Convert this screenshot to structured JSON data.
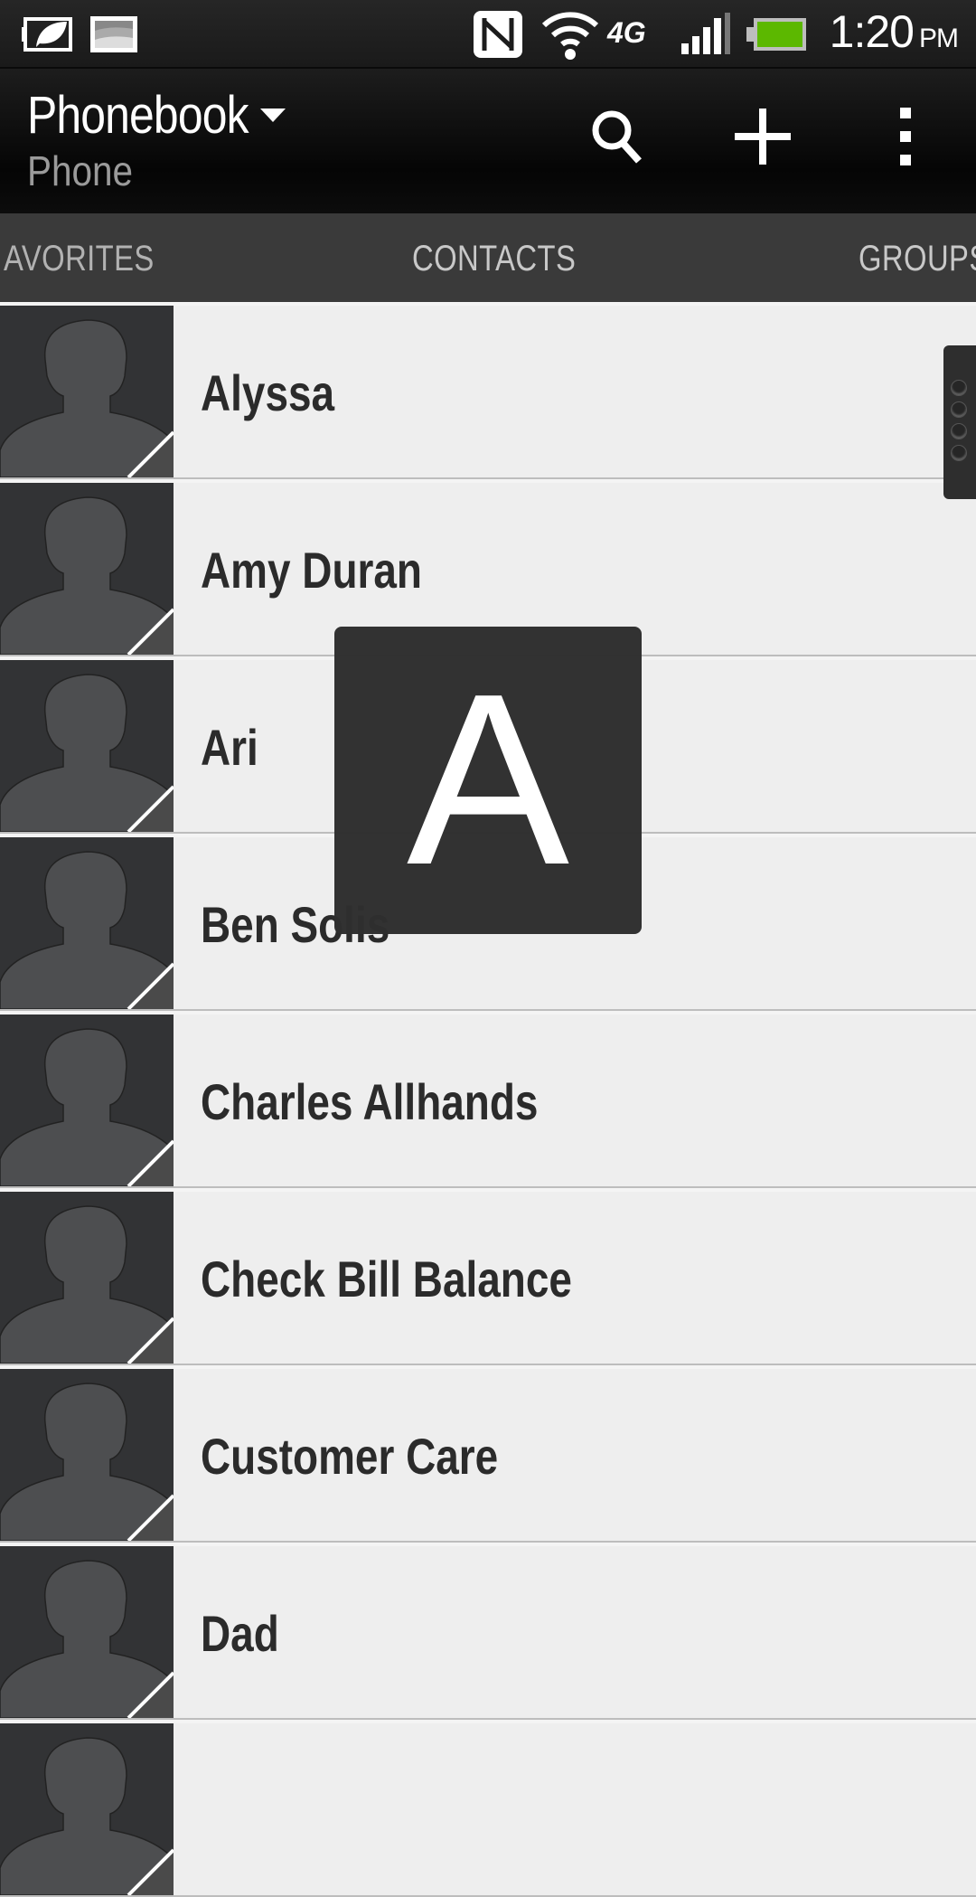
{
  "status_bar": {
    "icons": [
      "power-saver-icon",
      "gallery-notification-icon",
      "nfc-icon",
      "wifi-icon",
      "network-4g-icon",
      "signal-icon",
      "battery-icon"
    ],
    "network_label": "4G",
    "time": "1:20",
    "ampm": "PM",
    "battery_color": "#5cb800"
  },
  "header": {
    "title": "Phonebook",
    "subtitle": "Phone",
    "actions": [
      "search-icon",
      "add-icon",
      "overflow-menu-icon"
    ]
  },
  "tabs": [
    {
      "label": "AVORITES",
      "full": "FAVORITES"
    },
    {
      "label": "CONTACTS",
      "active": true
    },
    {
      "label": "GROUPS"
    }
  ],
  "contacts": [
    {
      "name": "Alyssa"
    },
    {
      "name": "Amy Duran"
    },
    {
      "name": "Ari"
    },
    {
      "name": "Ben Solis"
    },
    {
      "name": "Charles Allhands"
    },
    {
      "name": "Check Bill Balance"
    },
    {
      "name": "Customer Care"
    },
    {
      "name": "Dad"
    },
    {
      "name": ""
    }
  ],
  "fast_scroll": {
    "letter": "A"
  }
}
